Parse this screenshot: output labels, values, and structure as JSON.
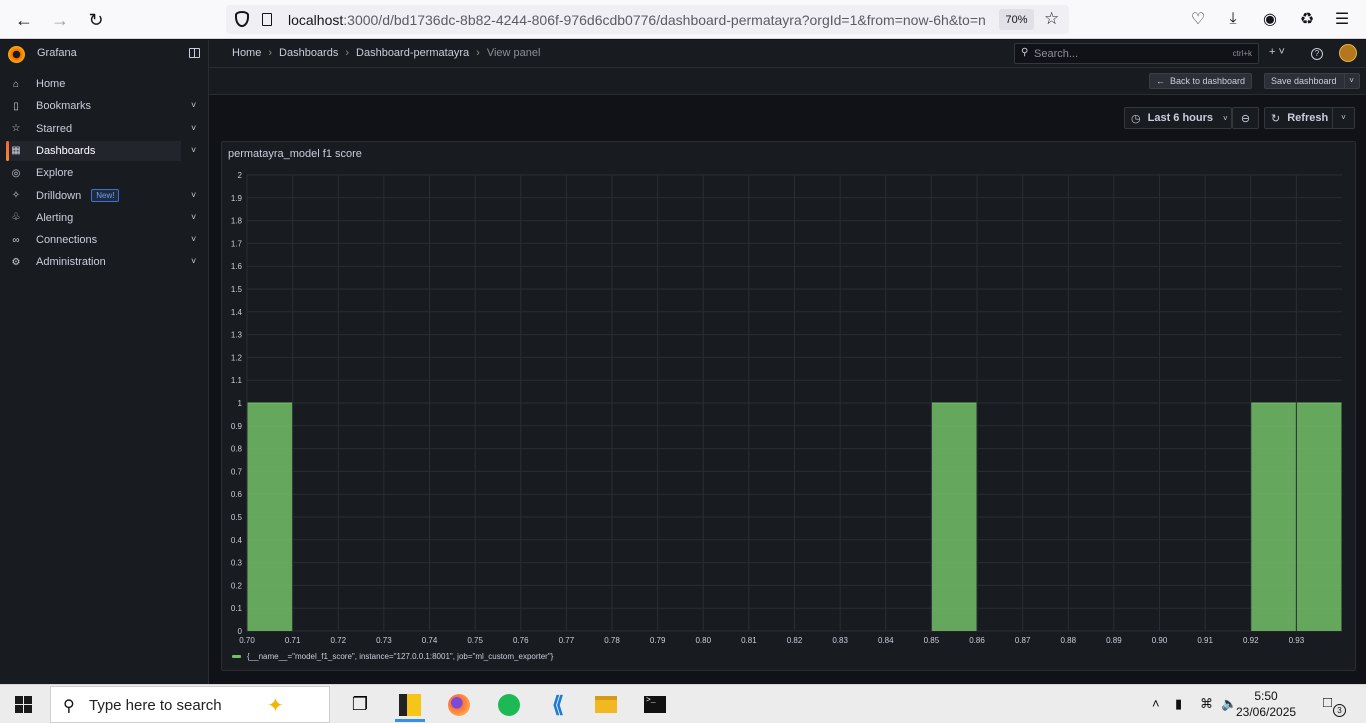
{
  "browser": {
    "url_host": "localhost",
    "url_rest": ":3000/d/bd1736dc-8b82-4244-806f-976d6cdb0776/dashboard-permatayra?orgId=1&from=now-6h&to=n",
    "zoom": "70%"
  },
  "grafana": {
    "brand": "Grafana",
    "nav": [
      {
        "label": "Home",
        "icon": "home-icon",
        "has_children": false,
        "active": false
      },
      {
        "label": "Bookmarks",
        "icon": "bookmark-icon",
        "has_children": true,
        "active": false
      },
      {
        "label": "Starred",
        "icon": "star-icon",
        "has_children": true,
        "active": false
      },
      {
        "label": "Dashboards",
        "icon": "dashboards-icon",
        "has_children": true,
        "active": true
      },
      {
        "label": "Explore",
        "icon": "compass-icon",
        "has_children": false,
        "active": false
      },
      {
        "label": "Drilldown",
        "icon": "drilldown-icon",
        "has_children": true,
        "active": false,
        "badge": "New!"
      },
      {
        "label": "Alerting",
        "icon": "bell-icon",
        "has_children": true,
        "active": false
      },
      {
        "label": "Connections",
        "icon": "connections-icon",
        "has_children": true,
        "active": false
      },
      {
        "label": "Administration",
        "icon": "gear-icon",
        "has_children": true,
        "active": false
      }
    ],
    "breadcrumbs": [
      "Home",
      "Dashboards",
      "Dashboard-permatayra",
      "View panel"
    ],
    "search_placeholder": "Search...",
    "search_shortcut": "ctrl+k",
    "back_button": "Back to dashboard",
    "save_button": "Save dashboard",
    "time_range": "Last 6 hours",
    "refresh": "Refresh"
  },
  "panel": {
    "title": "permatayra_model f1 score",
    "legend": "{__name__=\"model_f1_score\", instance=\"127.0.0.1:8001\", job=\"ml_custom_exporter\"}"
  },
  "chart_data": {
    "type": "bar",
    "title": "permatayra_model f1 score",
    "xlabel": "",
    "ylabel": "",
    "x_ticks": [
      "0.70",
      "0.71",
      "0.72",
      "0.73",
      "0.74",
      "0.75",
      "0.76",
      "0.77",
      "0.78",
      "0.79",
      "0.80",
      "0.81",
      "0.82",
      "0.83",
      "0.84",
      "0.85",
      "0.86",
      "0.87",
      "0.88",
      "0.89",
      "0.90",
      "0.91",
      "0.92",
      "0.93"
    ],
    "y_ticks": [
      "0",
      "0.1",
      "0.2",
      "0.3",
      "0.4",
      "0.5",
      "0.6",
      "0.7",
      "0.8",
      "0.9",
      "1",
      "1.1",
      "1.2",
      "1.3",
      "1.4",
      "1.5",
      "1.6",
      "1.7",
      "1.8",
      "1.9",
      "2"
    ],
    "xlim": [
      0.7,
      0.94
    ],
    "ylim": [
      0,
      2
    ],
    "bins": [
      {
        "x0": 0.7,
        "x1": 0.71,
        "value": 1
      },
      {
        "x0": 0.85,
        "x1": 0.86,
        "value": 1
      },
      {
        "x0": 0.92,
        "x1": 0.93,
        "value": 1
      },
      {
        "x0": 0.93,
        "x1": 0.94,
        "value": 1
      }
    ],
    "series_color": "#73bf69",
    "grid": true
  },
  "taskbar": {
    "search_placeholder": "Type here to search",
    "time": "5:50",
    "date": "23/06/2025",
    "notifications": "3"
  }
}
